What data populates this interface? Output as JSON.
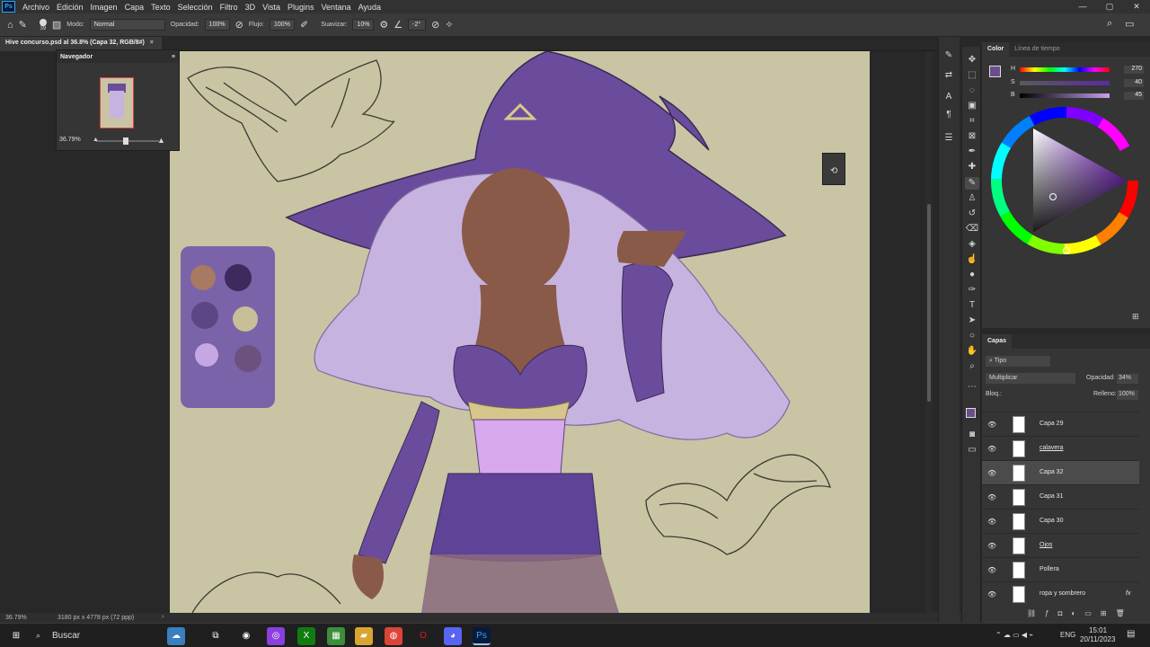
{
  "app": {
    "logo": "Ps"
  },
  "menu": [
    "Archivo",
    "Edición",
    "Imagen",
    "Capa",
    "Texto",
    "Selección",
    "Filtro",
    "3D",
    "Vista",
    "Plugins",
    "Ventana",
    "Ayuda"
  ],
  "window_controls": {
    "minimize": "—",
    "maximize": "▢",
    "close": "✕"
  },
  "options": {
    "brush_size": "39",
    "mode_label": "Modo:",
    "mode_value": "Normal",
    "opacity_label": "Opacidad:",
    "opacity_value": "100%",
    "flow_label": "Flujo:",
    "flow_value": "100%",
    "smooth_label": "Suavizar:",
    "smooth_value": "10%",
    "angle_value": "-2°"
  },
  "document": {
    "tab_title": "Hive concurso.psd al 36.8% (Capa 32, RGB/8#)",
    "tab_close": "×"
  },
  "navigator": {
    "title": "Navegador",
    "zoom": "36.79%"
  },
  "status": {
    "zoom": "36.79%",
    "doc_info": "3180 px x 4778 px (72 ppp)"
  },
  "color_panel": {
    "tab_color": "Color",
    "tab_timeline": "Línea de tiempo",
    "h_label": "H",
    "h_value": "270",
    "s_label": "S",
    "s_value": "40",
    "b_label": "B",
    "b_value": "45",
    "foreground": "#6b4f8a"
  },
  "layers_panel": {
    "tab": "Capas",
    "filter": "Tipo",
    "blend_mode": "Multiplicar",
    "opacity_label": "Opacidad:",
    "opacity_value": "34%",
    "lock_label": "Bloq.:",
    "fill_label": "Relleno:",
    "fill_value": "100%",
    "layers": [
      {
        "name": "Capa 29"
      },
      {
        "name": "calavera"
      },
      {
        "name": "Capa 32"
      },
      {
        "name": "Capa 31"
      },
      {
        "name": "Capa 30"
      },
      {
        "name": "Ojos"
      },
      {
        "name": "Pollera"
      },
      {
        "name": "ropa y sombrero"
      }
    ],
    "fx_label": "fx"
  },
  "taskbar": {
    "search_placeholder": "Buscar",
    "lang": "ENG",
    "time": "15:01",
    "date": "20/11/2023"
  }
}
